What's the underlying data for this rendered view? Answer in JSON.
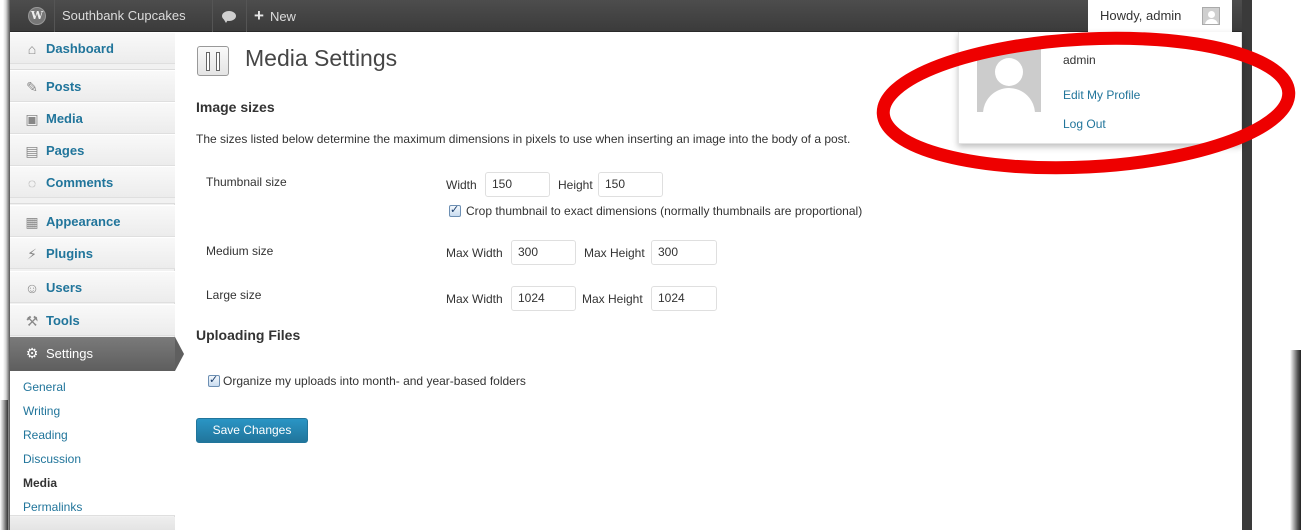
{
  "admin_bar": {
    "wp_logo": "wordpress-logo",
    "site_name": "Southbank Cupcakes",
    "comments_icon": "comment-bubble-icon",
    "new_label": "New",
    "new_icon": "+",
    "howdy": "Howdy, admin"
  },
  "side_menu": {
    "items": [
      {
        "label": "Dashboard",
        "icon": "⌂"
      },
      {
        "label": "Posts",
        "icon": "✎"
      },
      {
        "label": "Media",
        "icon": "▣"
      },
      {
        "label": "Pages",
        "icon": "▤"
      },
      {
        "label": "Comments",
        "icon": "◌"
      },
      {
        "label": "Appearance",
        "icon": "▦"
      },
      {
        "label": "Plugins",
        "icon": "⚡"
      },
      {
        "label": "Users",
        "icon": "☺"
      },
      {
        "label": "Tools",
        "icon": "⚒"
      },
      {
        "label": "Settings",
        "icon": "⚙"
      }
    ],
    "submenu": [
      "General",
      "Writing",
      "Reading",
      "Discussion",
      "Media",
      "Permalinks"
    ],
    "current_submenu": "Media"
  },
  "main": {
    "page_title": "Media Settings",
    "image_sizes_title": "Image sizes",
    "image_sizes_desc": "The sizes listed below determine the maximum dimensions in pixels to use when inserting an image into the body of a post.",
    "thumbnail": {
      "label": "Thumbnail size",
      "width_label": "Width",
      "width_value": "150",
      "height_label": "Height",
      "height_value": "150",
      "crop_label": "Crop thumbnail to exact dimensions (normally thumbnails are proportional)",
      "crop_checked": true
    },
    "medium": {
      "label": "Medium size",
      "max_width_label": "Max Width",
      "max_width_value": "300",
      "max_height_label": "Max Height",
      "max_height_value": "300"
    },
    "large": {
      "label": "Large size",
      "max_width_label": "Max Width",
      "max_width_value": "1024",
      "max_height_label": "Max Height",
      "max_height_value": "1024"
    },
    "uploading_title": "Uploading Files",
    "organize_label": "Organize my uploads into month- and year-based folders",
    "organize_checked": true,
    "save_button": "Save Changes"
  },
  "user_dropdown": {
    "name": "admin",
    "edit_profile": "Edit My Profile",
    "log_out": "Log Out"
  },
  "colors": {
    "link": "#21759b",
    "annotation": "#ee0000",
    "admin_bar": "#464646"
  }
}
